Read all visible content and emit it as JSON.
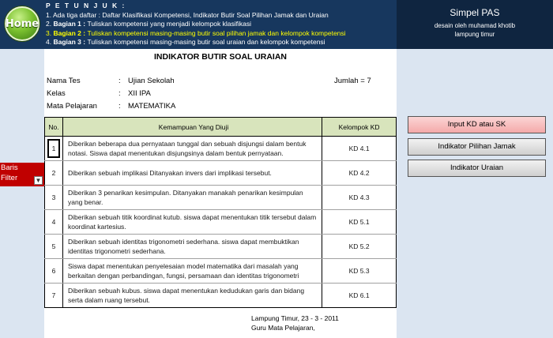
{
  "header": {
    "home_label": "Home",
    "petunjuk_title": "P E T U N J U K :",
    "steps": [
      {
        "num": "1.",
        "prefix": "",
        "text": "Ada tiga daftar : Daftar Klasifikasi Kompetensi, Indikator Butir Soal Pilihan Jamak dan Uraian"
      },
      {
        "num": "2.",
        "prefix": "Bagian 1 : ",
        "text": "Tuliskan kompetensi yang menjadi kelompok klasifikasi"
      },
      {
        "num": "3.",
        "prefix": "Bagian 2 : ",
        "text": "Tuliskan kompetensi masing-masing butir soal pilihan jamak dan kelompok kompetensi"
      },
      {
        "num": "4.",
        "prefix": "Bagian 3 : ",
        "text": "Tuliskan kompetensi masing-masing butir soal uraian dan kelompok kompetensi"
      }
    ],
    "brand_name": "Simpel PAS",
    "brand_sub": "desain oleh muhamad khotib",
    "brand_loc": "lampung timur",
    "highlight_color": "#ffff00"
  },
  "left": {
    "baris_label": "Baris",
    "filter_label": "Filter",
    "filter_icon": "filter-dropdown-icon"
  },
  "document": {
    "title": "INDIKATOR BUTIR SOAL URAIAN",
    "meta": [
      {
        "label": "Nama Tes",
        "value": "Ujian Sekolah"
      },
      {
        "label": "Kelas",
        "value": "XII IPA"
      },
      {
        "label": "Mata Pelajaran",
        "value": "MATEMATIKA"
      }
    ],
    "colon": ":",
    "jumlah": "Jumlah = 7",
    "columns": {
      "no": "No.",
      "kemampuan": "Kemampuan Yang Diuji",
      "kelompok": "Kelompok KD"
    },
    "rows": [
      {
        "no": "1",
        "kemampuan": "Diberikan beberapa dua pernyataan tunggal dan sebuah disjungsi dalam bentuk notasi. Siswa dapat menentukan disjungsinya dalam bentuk pernyataan.",
        "kd": "KD 4.1"
      },
      {
        "no": "2",
        "kemampuan": "Diberikan sebuah implikasi Ditanyakan invers dari implikasi tersebut.",
        "kd": "KD 4.2"
      },
      {
        "no": "3",
        "kemampuan": "Diberikan 3 penarikan kesimpulan. Ditanyakan manakah penarikan kesimpulan yang benar.",
        "kd": "KD 4.3"
      },
      {
        "no": "4",
        "kemampuan": "Diberikan sebuah titik koordinat kutub. siswa dapat menentukan titik tersebut dalam koordinat kartesius.",
        "kd": "KD 5.1"
      },
      {
        "no": "5",
        "kemampuan": "Diberikan sebuah identitas trigonometri sederhana. siswa dapat membuktikan identitas trigonometri sederhana.",
        "kd": "KD 5.2"
      },
      {
        "no": "6",
        "kemampuan": "Siswa dapat menentukan penyelesaian model matematika dari masalah yang berkaitan dengan perbandingan, fungsi, persamaan dan identitas trigonometri",
        "kd": "KD 5.3"
      },
      {
        "no": "7",
        "kemampuan": "Diberikan sebuah kubus. siswa dapat menentukan kedudukan garis dan bidang serta dalam ruang tersebut.",
        "kd": "KD 6.1"
      }
    ],
    "footer_place_date": "Lampung Timur,  23 - 3 - 2011",
    "footer_role": "Guru Mata Pelajaran,"
  },
  "buttons": {
    "input_kd": "Input KD atau SK",
    "pilihan_jamak": "Indikator Pilihan Jamak",
    "uraian": "Indikator Uraian"
  }
}
